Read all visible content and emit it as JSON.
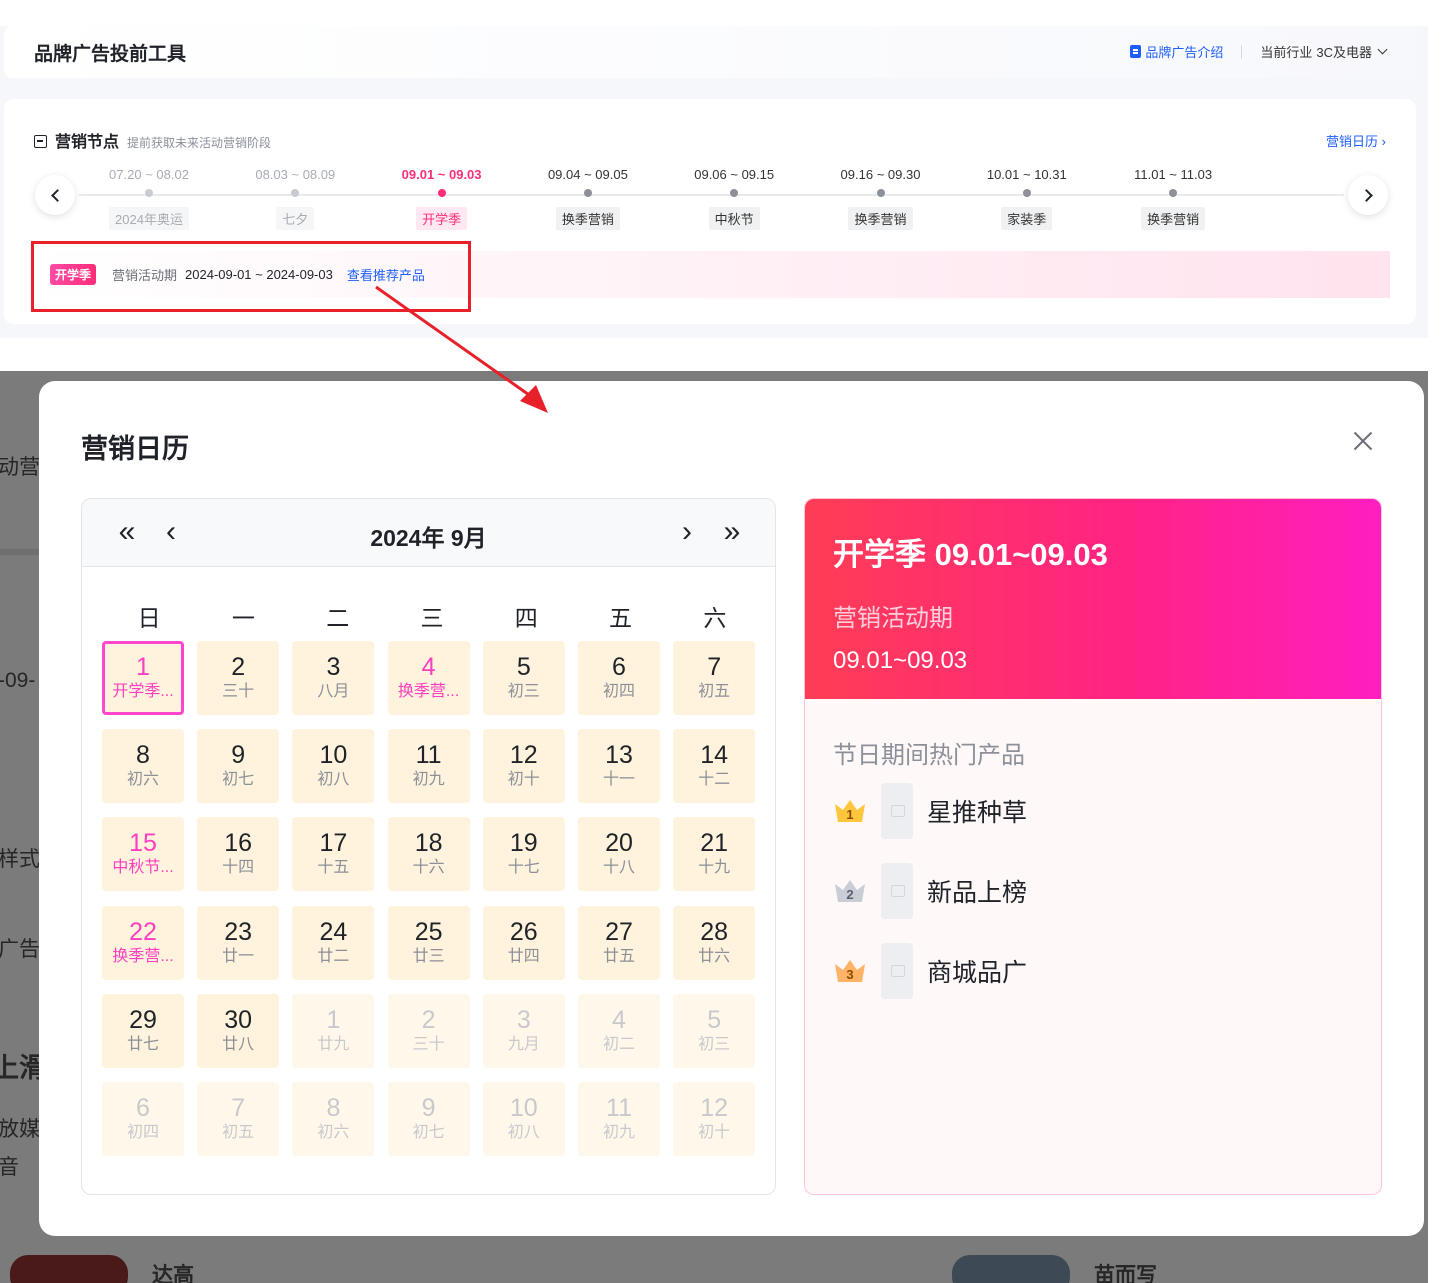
{
  "header": {
    "title": "品牌广告投前工具",
    "intro_link": "品牌广告介绍",
    "industry_label": "当前行业",
    "industry_value": "3C及电器"
  },
  "marketing_nodes": {
    "title": "营销节点",
    "subtitle": "提前获取未来活动营销阶段",
    "calendar_link": "营销日历",
    "nodes": [
      {
        "range": "07.20 ~ 08.02",
        "tag": "2024年奥运",
        "state": "past"
      },
      {
        "range": "08.03 ~ 08.09",
        "tag": "七夕",
        "state": "past"
      },
      {
        "range": "09.01 ~ 09.03",
        "tag": "开学季",
        "state": "active"
      },
      {
        "range": "09.04 ~ 09.05",
        "tag": "换季营销",
        "state": "future"
      },
      {
        "range": "09.06 ~ 09.15",
        "tag": "中秋节",
        "state": "future"
      },
      {
        "range": "09.16 ~ 09.30",
        "tag": "换季营销",
        "state": "future"
      },
      {
        "range": "10.01 ~ 10.31",
        "tag": "家装季",
        "state": "future"
      },
      {
        "range": "11.01 ~ 11.03",
        "tag": "换季营销",
        "state": "future"
      }
    ],
    "active_bar": {
      "tag": "开学季",
      "label": "营销活动期",
      "dates": "2024-09-01 ~ 2024-09-03",
      "link": "查看推荐产品"
    }
  },
  "background_fragments": [
    "动营",
    "-09-",
    "样式",
    "广告",
    "上滑",
    "放媒",
    "音",
    "达高",
    "苗而写"
  ],
  "modal": {
    "title": "营销日历",
    "calendar": {
      "month_title": "2024年 9月",
      "nav": {
        "prev_year": "«",
        "prev_month": "‹",
        "next_month": "›",
        "next_year": "»"
      },
      "weekdays": [
        "日",
        "一",
        "二",
        "三",
        "四",
        "五",
        "六"
      ],
      "days": [
        {
          "d": "1",
          "l": "开学季...",
          "fest": true,
          "sel": true
        },
        {
          "d": "2",
          "l": "三十"
        },
        {
          "d": "3",
          "l": "八月"
        },
        {
          "d": "4",
          "l": "换季营...",
          "fest": true
        },
        {
          "d": "5",
          "l": "初三"
        },
        {
          "d": "6",
          "l": "初四"
        },
        {
          "d": "7",
          "l": "初五"
        },
        {
          "d": "8",
          "l": "初六"
        },
        {
          "d": "9",
          "l": "初七"
        },
        {
          "d": "10",
          "l": "初八"
        },
        {
          "d": "11",
          "l": "初九"
        },
        {
          "d": "12",
          "l": "初十"
        },
        {
          "d": "13",
          "l": "十一"
        },
        {
          "d": "14",
          "l": "十二"
        },
        {
          "d": "15",
          "l": "中秋节...",
          "fest": true
        },
        {
          "d": "16",
          "l": "十四"
        },
        {
          "d": "17",
          "l": "十五"
        },
        {
          "d": "18",
          "l": "十六"
        },
        {
          "d": "19",
          "l": "十七"
        },
        {
          "d": "20",
          "l": "十八"
        },
        {
          "d": "21",
          "l": "十九"
        },
        {
          "d": "22",
          "l": "换季营...",
          "fest": true
        },
        {
          "d": "23",
          "l": "廿一"
        },
        {
          "d": "24",
          "l": "廿二"
        },
        {
          "d": "25",
          "l": "廿三"
        },
        {
          "d": "26",
          "l": "廿四"
        },
        {
          "d": "27",
          "l": "廿五"
        },
        {
          "d": "28",
          "l": "廿六"
        },
        {
          "d": "29",
          "l": "廿七"
        },
        {
          "d": "30",
          "l": "廿八"
        },
        {
          "d": "1",
          "l": "廿九",
          "other": true
        },
        {
          "d": "2",
          "l": "三十",
          "other": true
        },
        {
          "d": "3",
          "l": "九月",
          "other": true
        },
        {
          "d": "4",
          "l": "初二",
          "other": true
        },
        {
          "d": "5",
          "l": "初三",
          "other": true
        },
        {
          "d": "6",
          "l": "初四",
          "other": true
        },
        {
          "d": "7",
          "l": "初五",
          "other": true
        },
        {
          "d": "8",
          "l": "初六",
          "other": true
        },
        {
          "d": "9",
          "l": "初七",
          "other": true
        },
        {
          "d": "10",
          "l": "初八",
          "other": true
        },
        {
          "d": "11",
          "l": "初九",
          "other": true
        },
        {
          "d": "12",
          "l": "初十",
          "other": true
        }
      ]
    },
    "detail": {
      "title": "开学季 09.01~09.03",
      "period_label": "营销活动期",
      "period_range": "09.01~09.03",
      "hot_title": "节日期间热门产品",
      "products": [
        {
          "rank": "1",
          "name": "星推种草",
          "medal_color": "#ffc53d"
        },
        {
          "rank": "2",
          "name": "新品上榜",
          "medal_color": "#c9ced6"
        },
        {
          "rank": "3",
          "name": "商城品广",
          "medal_color": "#ffb366"
        }
      ]
    }
  },
  "colors": {
    "accent": "#ff2d7a",
    "link": "#1e5eff",
    "festival": "#ff3fbf",
    "annotation": "#e8202a"
  }
}
